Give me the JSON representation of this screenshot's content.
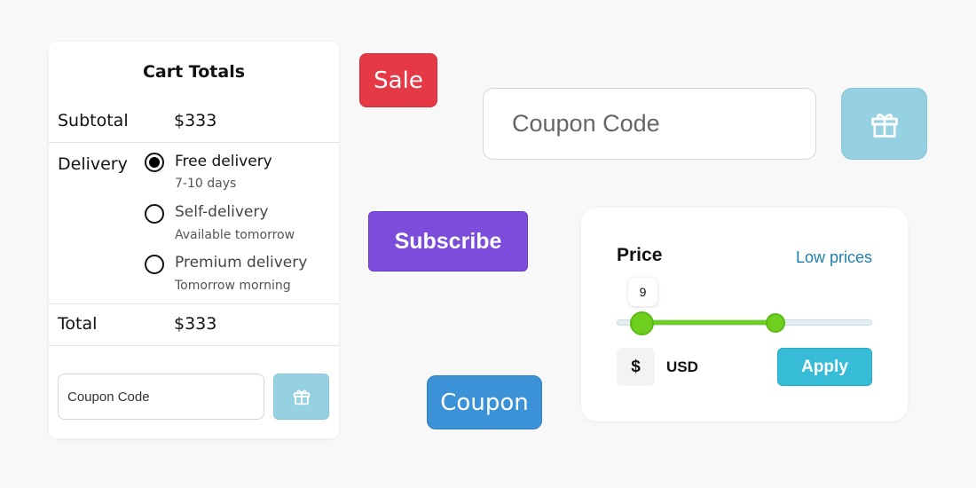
{
  "cart": {
    "title": "Cart Totals",
    "subtotal_label": "Subtotal",
    "subtotal_value": "$333",
    "delivery_label": "Delivery",
    "delivery_options": [
      {
        "title": "Free delivery",
        "subtitle": "7-10 days",
        "selected": true
      },
      {
        "title": "Self-delivery",
        "subtitle": "Available tomorrow",
        "selected": false
      },
      {
        "title": "Premium delivery",
        "subtitle": "Tomorrow morning",
        "selected": false
      }
    ],
    "total_label": "Total",
    "total_value": "$333",
    "coupon_placeholder": "Coupon Code",
    "gift_icon": "gift-icon"
  },
  "sale_badge": {
    "label": "Sale",
    "color": "#e63946"
  },
  "coupon_large": {
    "placeholder": "Coupon Code",
    "gift_icon": "gift-icon"
  },
  "subscribe_button": {
    "label": "Subscribe",
    "color": "#7c4ddb"
  },
  "coupon_button": {
    "label": "Coupon",
    "color": "#3c92d6"
  },
  "price_filter": {
    "title": "Price",
    "link": "Low prices",
    "slider_value": "9",
    "slider_low_fraction": 0.1,
    "slider_high_fraction": 0.62,
    "currency_symbol": "$",
    "currency_code": "USD",
    "apply_label": "Apply",
    "accent_color": "#6fcf1f",
    "apply_color": "#36bcd6"
  }
}
